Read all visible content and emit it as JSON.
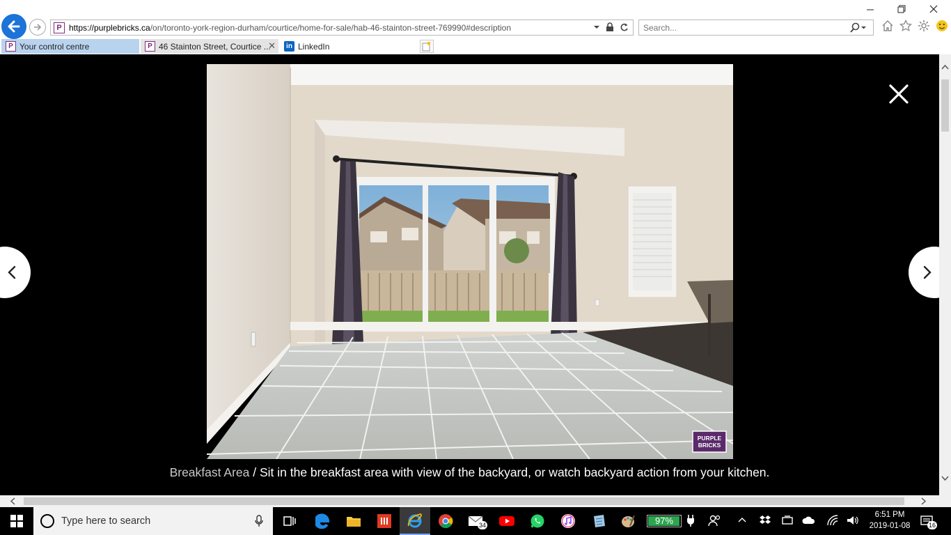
{
  "browser": {
    "url_host": "https://purplebricks.ca",
    "url_path": "/on/toronto-york-region-durham/courtice/home-for-sale/hab-46-stainton-street-769990#description",
    "search_placeholder": "Search...",
    "tabs": [
      {
        "label": "Your control centre",
        "icon": "purplebricks-favicon"
      },
      {
        "label": "46 Stainton Street, Courtice ...",
        "icon": "purplebricks-favicon"
      },
      {
        "label": "LinkedIn",
        "icon": "linkedin-favicon"
      }
    ],
    "favicon_letter": "P",
    "linkedin_letter": "in"
  },
  "lightbox": {
    "caption_title": "Breakfast Area",
    "caption_separator": " / ",
    "caption_text": "Sit in the breakfast area with view of the backyard, or watch backyard action from your kitchen.",
    "watermark_line1": "PURPLE",
    "watermark_line2": "BRICKS"
  },
  "taskbar": {
    "search_placeholder": "Type here to search",
    "mail_badge": "34",
    "battery_percent": "97%",
    "time": "6:51 PM",
    "date": "2019-01-08",
    "notification_count": "16"
  },
  "colors": {
    "brand_purple": "#5a2a6b",
    "ie_blue": "#1c73d8",
    "battery_green": "#2ea44f"
  }
}
